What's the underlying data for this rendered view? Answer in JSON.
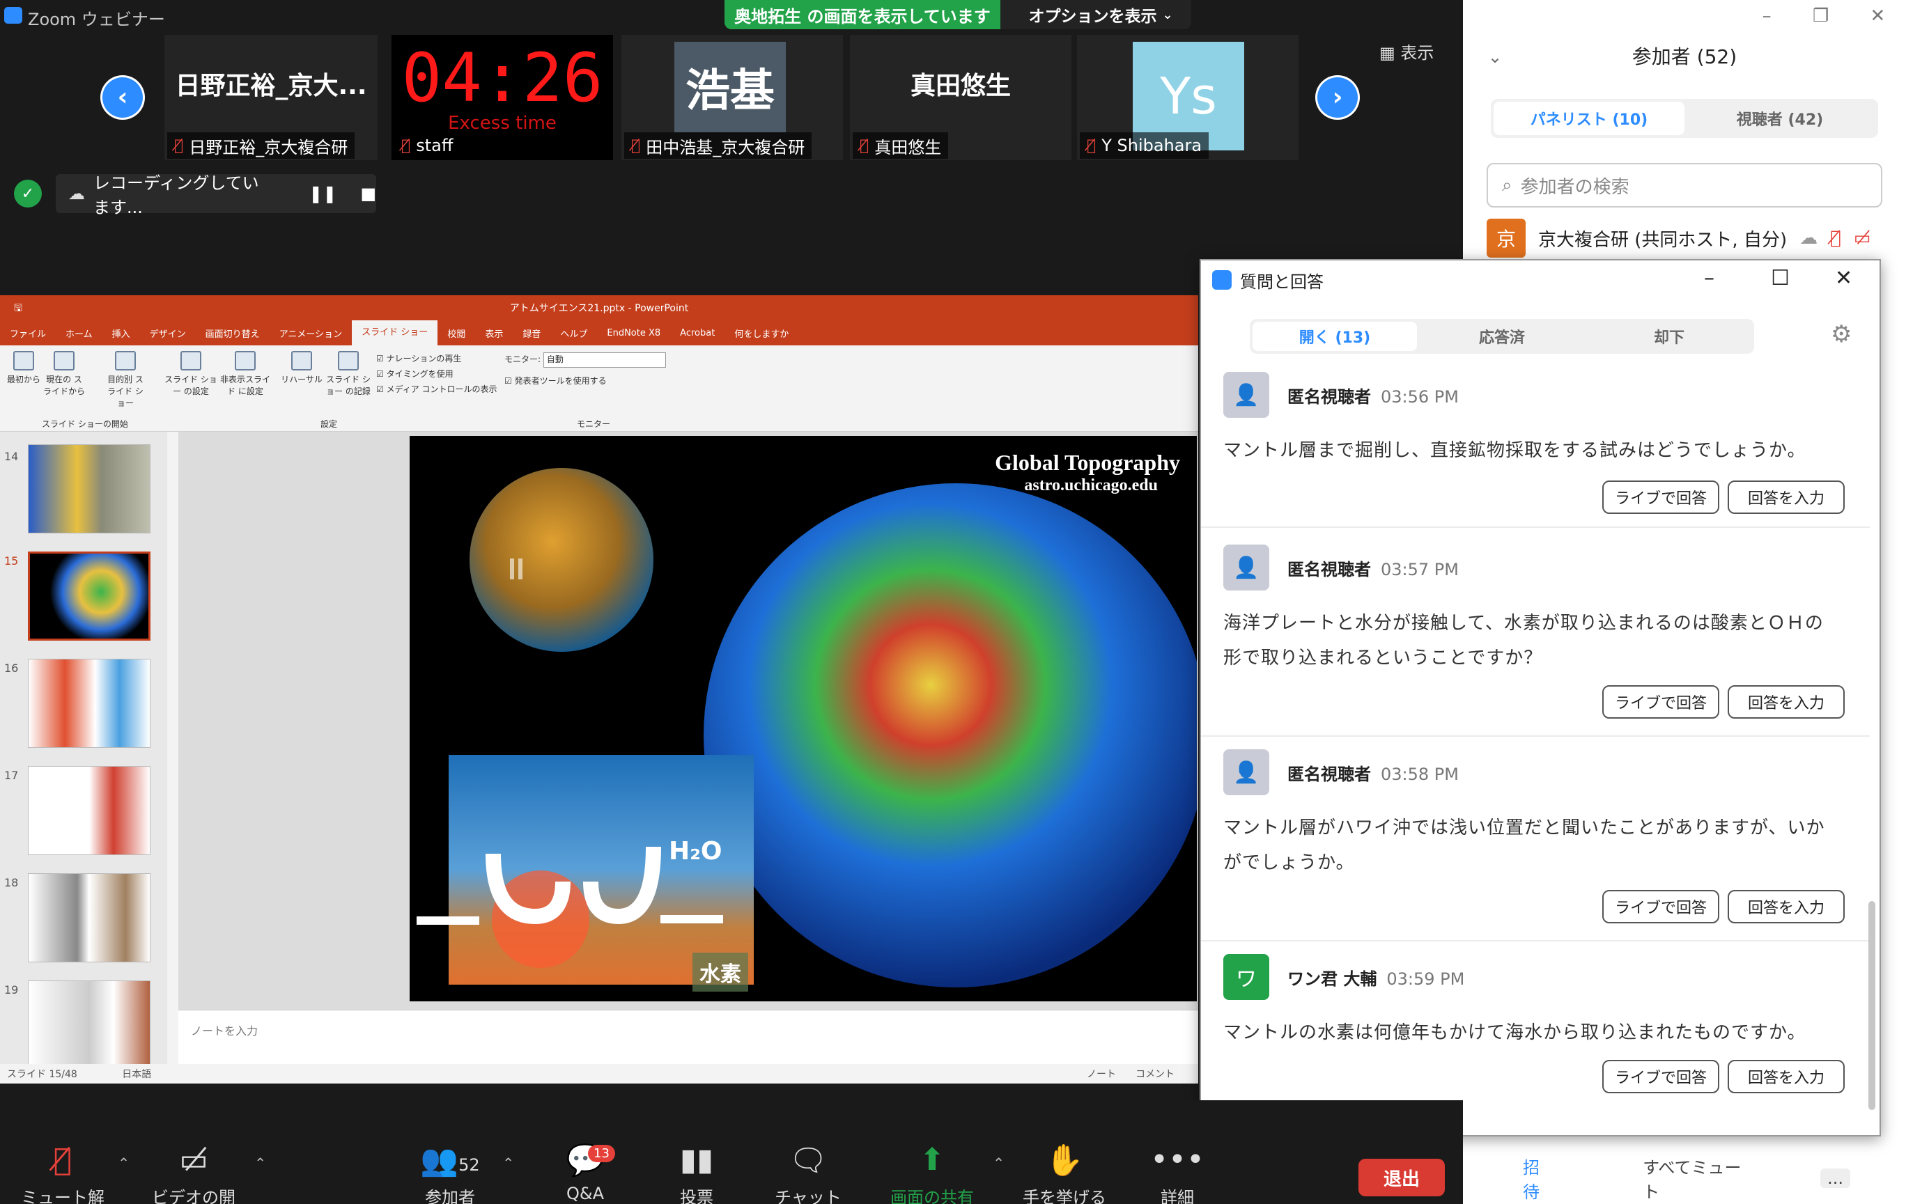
{
  "window": {
    "title": "Zoom ウェビナー"
  },
  "share_banner": {
    "status": "奥地拓生 の画面を表示しています",
    "options": "オプションを表示"
  },
  "video_strip": {
    "view_label": "表示",
    "tiles": [
      {
        "display": "日野正裕_京大...",
        "label": "日野正裕_京大複合研"
      },
      {
        "display": "04:26",
        "sub": "Excess time",
        "label": "staff"
      },
      {
        "display": "浩基",
        "label": "田中浩基_京大複合研"
      },
      {
        "display": "真田悠生",
        "label": "真田悠生"
      },
      {
        "display": "Ys",
        "label": "Y Shibahara"
      }
    ]
  },
  "recording": {
    "text": "レコーディングしています..."
  },
  "powerpoint": {
    "title": "アトムサイエンス21.pptx - PowerPoint",
    "tabs": [
      "ファイル",
      "ホーム",
      "挿入",
      "デザイン",
      "画面切り替え",
      "アニメーション",
      "スライド ショー",
      "校閲",
      "表示",
      "録音",
      "ヘルプ",
      "EndNote X8",
      "Acrobat",
      "何をしますか"
    ],
    "ribbon": {
      "start_from_beginning": "最初から",
      "from_current": "現在の スライドから",
      "custom_show": "目的別 スライド ショー",
      "setup": "スライド ショー の設定",
      "hide_slide": "非表示スライド に設定",
      "rehearse": "リハーサル",
      "record": "スライド ショー の記録",
      "play_narration": "ナレーションの再生",
      "use_timings": "タイミングを使用",
      "media_controls": "メディア コントロールの表示",
      "monitor_label": "モニター:",
      "monitor_value": "自動",
      "presenter_view": "発表者ツールを使用する",
      "group_start": "スライド ショーの開始",
      "group_setup": "設定",
      "group_monitor": "モニター"
    },
    "thumb_numbers": [
      "14",
      "15",
      "16",
      "17",
      "18",
      "19"
    ],
    "slide": {
      "title": "Global Topography",
      "subtitle": "astro.uchicago.edu",
      "h2o_label": "H₂O",
      "hydrogen_label": "水素"
    },
    "notes_placeholder": "ノートを入力",
    "status": {
      "slide": "スライド 15/48",
      "language": "日本語",
      "notes": "ノート",
      "comments": "コメント"
    }
  },
  "participants": {
    "header": "参加者 (52)",
    "tab_panelists": "パネリスト (10)",
    "tab_attendees": "視聴者 (42)",
    "search_placeholder": "参加者の検索",
    "me": {
      "initial": "京",
      "name": "京大複合研 (共同ホスト, 自分)"
    },
    "footer_invite": "招待",
    "footer_mute_all": "すべてミュート",
    "footer_more": "..."
  },
  "qa": {
    "title": "質問と回答",
    "tab_open": "開く (13)",
    "tab_answered": "応答済",
    "tab_dismissed": "却下",
    "answer_live": "ライブで回答",
    "type_answer": "回答を入力",
    "items": [
      {
        "author": "匿名視聴者",
        "time": "03:56 PM",
        "text": "マントル層まで掘削し、直接鉱物採取をする試みはどうでしょうか。"
      },
      {
        "author": "匿名視聴者",
        "time": "03:57 PM",
        "text": "海洋プレートと水分が接触して、水素が取り込まれるのは酸素とＯＨの形で取り込まれるということですか？"
      },
      {
        "author": "匿名視聴者",
        "time": "03:58 PM",
        "text": "マントル層がハワイ沖では浅い位置だと聞いたことがありますが、いかがでしょうか。"
      },
      {
        "author": "ワン君 大輔",
        "time": "03:59 PM",
        "initial": "ワ",
        "text": "マントルの水素は何億年もかけて海水から取り込まれたものですか。"
      }
    ]
  },
  "toolbar": {
    "unmute": "ミュート解除",
    "start_video": "ビデオの開始",
    "participants": "参加者",
    "participants_count": "52",
    "qa": "Q&A",
    "qa_badge": "13",
    "polls": "投票",
    "chat": "チャット",
    "share": "画面の共有",
    "raise_hand": "手を挙げる",
    "more": "詳細",
    "leave": "退出"
  },
  "colors": {
    "zoom_blue": "#2d8cff",
    "share_green": "#22a34a",
    "ppt_orange": "#c43e1c",
    "leave_red": "#d93a32"
  }
}
